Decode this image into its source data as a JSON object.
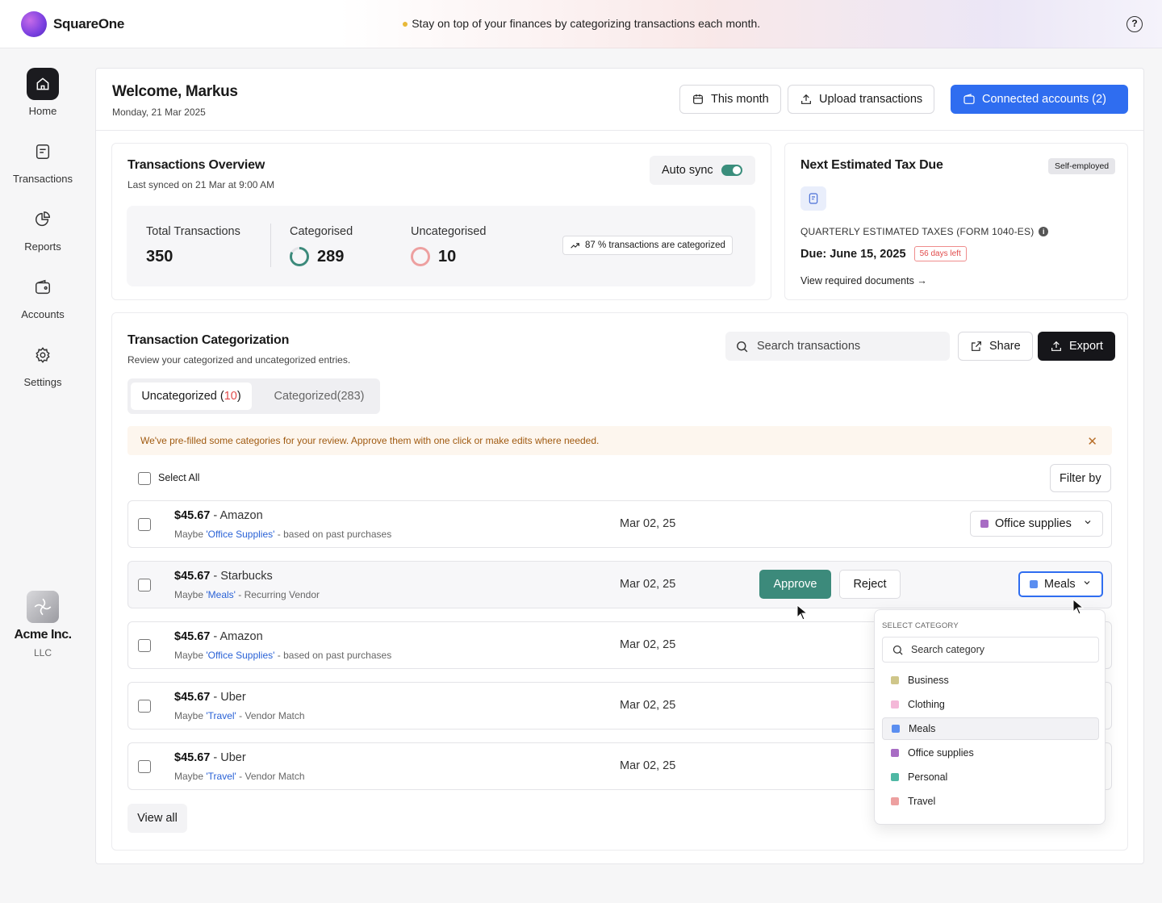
{
  "app": {
    "name": "SquareOne",
    "tip_icon": "lightbulb-icon",
    "tip": "Stay on top of your finances by categorizing transactions each month."
  },
  "sidebar": {
    "items": [
      {
        "label": "Home",
        "icon": "home-icon",
        "active": true
      },
      {
        "label": "Transactions",
        "icon": "document-icon"
      },
      {
        "label": "Reports",
        "icon": "pie-chart-icon"
      },
      {
        "label": "Accounts",
        "icon": "wallet-icon"
      },
      {
        "label": "Settings",
        "icon": "gear-icon"
      }
    ],
    "org": {
      "name": "Acme Inc.",
      "type": "LLC"
    }
  },
  "header": {
    "welcome": "Welcome, Markus",
    "date": "Monday, 21 Mar 2025",
    "this_month": "This month",
    "upload": "Upload transactions",
    "connected": "Connected accounts (2)"
  },
  "overview": {
    "title": "Transactions Overview",
    "synced": "Last synced on 21 Mar at 9:00 AM",
    "auto_sync": "Auto sync",
    "auto_sync_on": true,
    "total_label": "Total Transactions",
    "total": "350",
    "cat_label": "Categorised",
    "cat": "289",
    "uncat_label": "Uncategorised",
    "uncat": "10",
    "pill": "87 % transactions are categorized"
  },
  "tax": {
    "title": "Next Estimated Tax Due",
    "badge": "Self-employed",
    "label": "QUARTERLY ESTIMATED TAXES (FORM 1040-ES)",
    "due": "Due: June 15, 2025",
    "days_left": "56 days left",
    "link": "View required documents"
  },
  "categorization": {
    "title": "Transaction Categorization",
    "subtitle": "Review your categorized and uncategorized entries.",
    "search_placeholder": "Search transactions",
    "share": "Share",
    "export": "Export",
    "tab_uncat": "Uncategorized (",
    "tab_uncat_count": "10",
    "tab_uncat_end": ")",
    "tab_cat": "Categorized(283)",
    "banner": "We've pre-filled some categories for your review. Approve them with one click or make edits where needed.",
    "select_all": "Select All",
    "filter": "Filter by",
    "view_all": "View all",
    "approve": "Approve",
    "reject": "Reject",
    "rows": [
      {
        "amount": "$45.67",
        "vendor": " - Amazon",
        "maybe": "Maybe ",
        "cat": "'Office Supplies'",
        "reason": " - based on past purchases",
        "date": "Mar 02, 25",
        "select": "Office supplies"
      },
      {
        "amount": "$45.67",
        "vendor": " - Starbucks",
        "maybe": "Maybe ",
        "cat": "'Meals'",
        "reason": " - Recurring Vendor",
        "date": "Mar 02, 25",
        "select": "Meals"
      },
      {
        "amount": "$45.67",
        "vendor": " - Amazon",
        "maybe": "Maybe ",
        "cat": "'Office Supplies'",
        "reason": " - based on past purchases",
        "date": "Mar 02, 25"
      },
      {
        "amount": "$45.67",
        "vendor": " - Uber",
        "maybe": "Maybe ",
        "cat": "'Travel'",
        "reason": " - Vendor Match",
        "date": "Mar 02, 25"
      },
      {
        "amount": "$45.67",
        "vendor": " - Uber",
        "maybe": "Maybe ",
        "cat": "'Travel'",
        "reason": " - Vendor Match",
        "date": "Mar 02, 25"
      }
    ]
  },
  "dropdown": {
    "title": "SELECT CATEGORY",
    "search_placeholder": "Search category",
    "selected": "Meals",
    "options": [
      {
        "label": "Business",
        "color": "#cfc68a"
      },
      {
        "label": "Clothing",
        "color": "#f4b8d8"
      },
      {
        "label": "Meals",
        "color": "#5b8ef0"
      },
      {
        "label": "Office supplies",
        "color": "#a86cc4"
      },
      {
        "label": "Personal",
        "color": "#4fb8a4"
      },
      {
        "label": "Travel",
        "color": "#eda0a0"
      }
    ]
  },
  "colors": {
    "primary": "#2f6df0",
    "approve": "#3c8a7b",
    "cat_ring": "#3c8a7b",
    "uncat_ring": "#eda0a0",
    "alert": "#e14b4b"
  }
}
